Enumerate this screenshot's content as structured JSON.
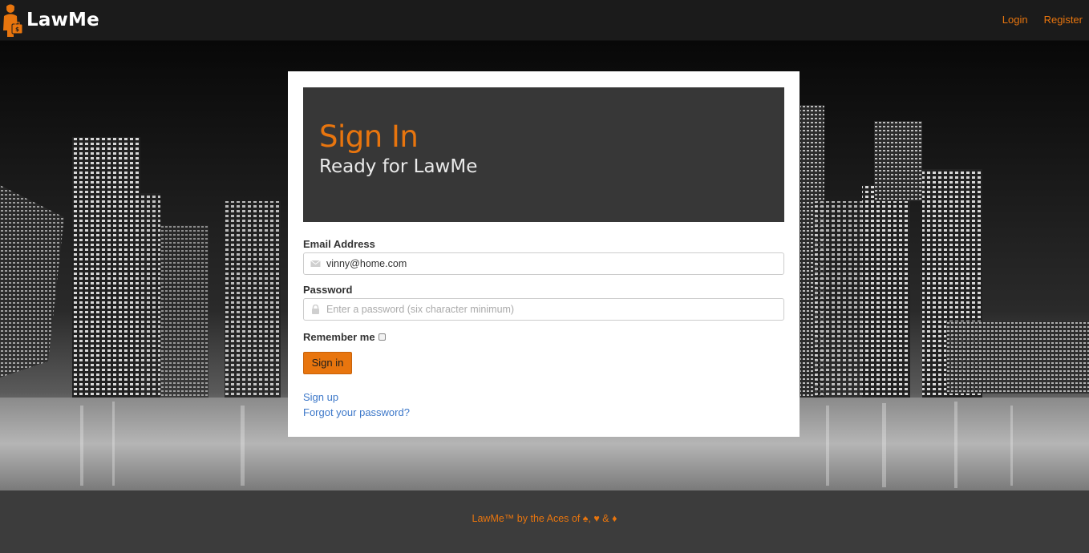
{
  "navbar": {
    "brand": "LawMe",
    "links": [
      "Login",
      "Register"
    ]
  },
  "signin": {
    "title": "Sign In",
    "subtitle": "Ready for LawMe",
    "email_label": "Email Address",
    "email_value": "vinny@home.com",
    "password_label": "Password",
    "password_placeholder": "Enter a password (six character minimum)",
    "remember_label": "Remember me",
    "remember_checked": false,
    "submit_label": "Sign in",
    "signup_link": "Sign up",
    "forgot_link": "Forgot your password?"
  },
  "footer": {
    "text": "LawMe™ by the Aces of ♠, ♥ & ♦"
  },
  "icons": {
    "logo": "lawyer-figure-icon",
    "email": "envelope-icon",
    "password": "lock-icon"
  },
  "colors": {
    "accent": "#e8750e",
    "navbar": "#1b1b1b",
    "jumbotron": "#373737",
    "link": "#3d78c9",
    "footer": "#3c3c3c"
  }
}
